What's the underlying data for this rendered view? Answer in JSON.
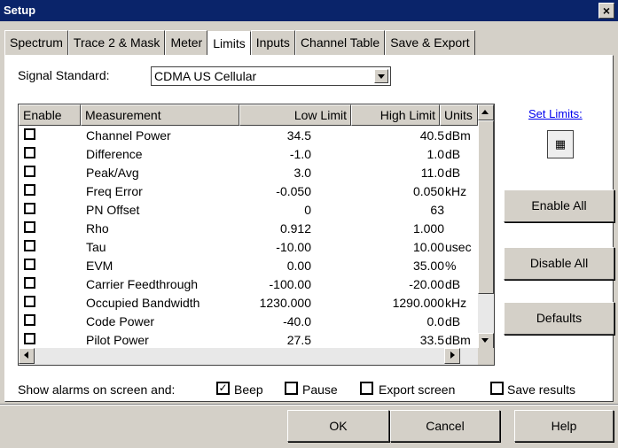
{
  "window": {
    "title": "Setup",
    "close_label": "×"
  },
  "tabs": [
    {
      "label": "Spectrum"
    },
    {
      "label": "Trace 2 & Mask"
    },
    {
      "label": "Meter"
    },
    {
      "label": "Limits"
    },
    {
      "label": "Inputs"
    },
    {
      "label": "Channel Table"
    },
    {
      "label": "Save & Export"
    }
  ],
  "active_tab": "Limits",
  "signal_standard": {
    "label": "Signal Standard:",
    "value": "CDMA US Cellular"
  },
  "table": {
    "headers": [
      "Enable",
      "Measurement",
      "Low Limit",
      "High Limit",
      "Units"
    ],
    "rows": [
      {
        "enabled": false,
        "measurement": "Channel Power",
        "low": "34.5",
        "high": "40.5",
        "units": "dBm"
      },
      {
        "enabled": false,
        "measurement": "Difference",
        "low": "-1.0",
        "high": "1.0",
        "units": "dB"
      },
      {
        "enabled": false,
        "measurement": "Peak/Avg",
        "low": "3.0",
        "high": "11.0",
        "units": "dB"
      },
      {
        "enabled": false,
        "measurement": "Freq Error",
        "low": "-0.050",
        "high": "0.050",
        "units": "kHz"
      },
      {
        "enabled": false,
        "measurement": "PN Offset",
        "low": "0",
        "high": "63",
        "units": ""
      },
      {
        "enabled": false,
        "measurement": "Rho",
        "low": "0.912",
        "high": "1.000",
        "units": ""
      },
      {
        "enabled": false,
        "measurement": "Tau",
        "low": "-10.00",
        "high": "10.00",
        "units": "usec"
      },
      {
        "enabled": false,
        "measurement": "EVM",
        "low": "0.00",
        "high": "35.00",
        "units": "%"
      },
      {
        "enabled": false,
        "measurement": "Carrier Feedthrough",
        "low": "-100.00",
        "high": "-20.00",
        "units": "dB"
      },
      {
        "enabled": false,
        "measurement": "Occupied Bandwidth",
        "low": "1230.000",
        "high": "1290.000",
        "units": "kHz"
      },
      {
        "enabled": false,
        "measurement": "Code Power",
        "low": "-40.0",
        "high": "0.0",
        "units": "dB"
      },
      {
        "enabled": false,
        "measurement": "Pilot Power",
        "low": "27.5",
        "high": "33.5",
        "units": "dBm"
      }
    ]
  },
  "side": {
    "set_limits": "Set Limits:",
    "calc_icon": "calculator-icon",
    "enable_all": "Enable All",
    "disable_all": "Disable All",
    "defaults": "Defaults"
  },
  "alarms": {
    "label": "Show alarms on screen and:",
    "beep": {
      "label": "Beep",
      "checked": true
    },
    "pause": {
      "label": "Pause",
      "checked": false
    },
    "export_screen": {
      "label": "Export screen",
      "checked": false
    },
    "save_results": {
      "label": "Save results",
      "checked": false
    }
  },
  "buttons": {
    "ok": "OK",
    "cancel": "Cancel",
    "help": "Help"
  }
}
